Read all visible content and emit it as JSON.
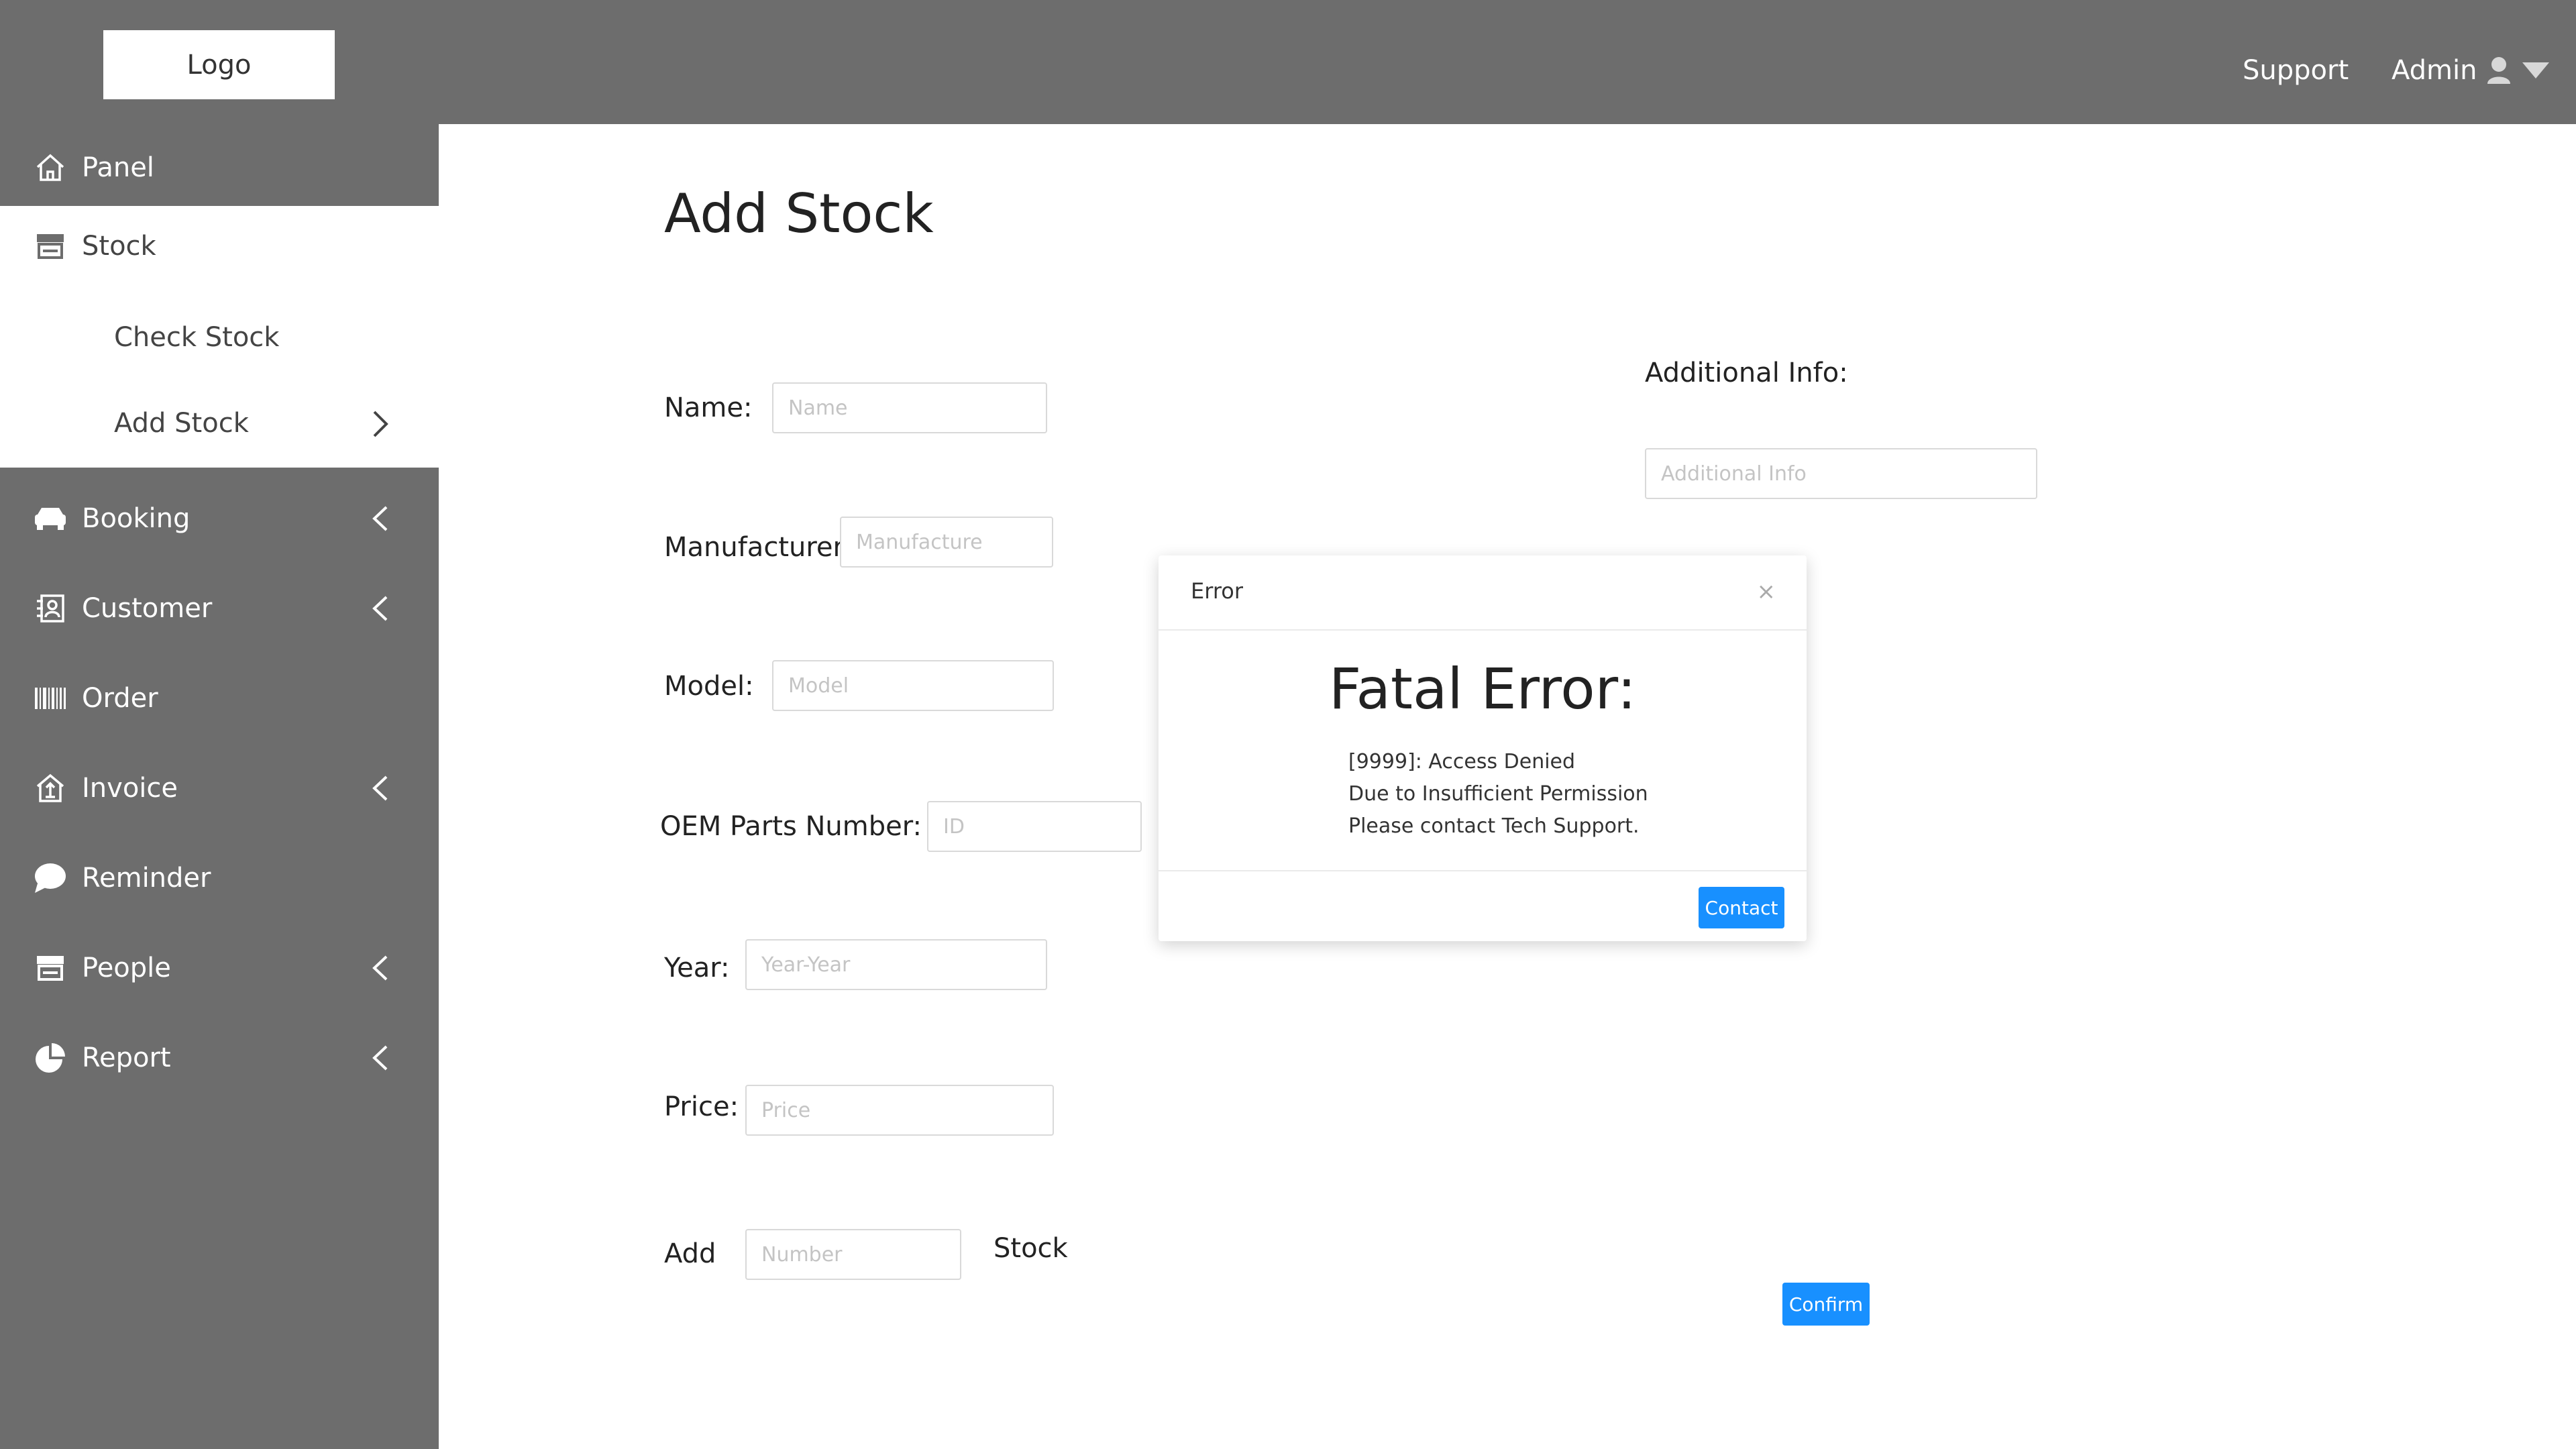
{
  "header": {
    "logo": "Logo",
    "support": "Support",
    "admin": "Admin"
  },
  "sidebar": {
    "items": [
      {
        "label": "Panel",
        "icon": "home-icon"
      },
      {
        "label": "Stock",
        "icon": "store-icon"
      },
      {
        "label": "Booking",
        "icon": "car-icon"
      },
      {
        "label": "Customer",
        "icon": "contact-card-icon"
      },
      {
        "label": "Order",
        "icon": "barcode-icon"
      },
      {
        "label": "Invoice",
        "icon": "invoice-icon"
      },
      {
        "label": "Reminder",
        "icon": "chat-bubble-icon"
      },
      {
        "label": "People",
        "icon": "store-icon"
      },
      {
        "label": "Report",
        "icon": "pie-chart-icon"
      }
    ],
    "stock_sub": [
      "Check Stock",
      "Add Stock"
    ]
  },
  "page": {
    "title": "Add Stock"
  },
  "form": {
    "name_label": "Name:",
    "name_placeholder": "Name",
    "manufacturer_label": "Manufacturer:",
    "manufacturer_placeholder": "Manufacture",
    "model_label": "Model:",
    "model_placeholder": "Model",
    "oem_label": "OEM Parts Number:",
    "oem_placeholder": "ID",
    "year_label": "Year:",
    "year_placeholder": "Year-Year",
    "price_label": "Price:",
    "price_placeholder": "Price",
    "add_label": "Add",
    "number_placeholder": "Number",
    "stock_label": "Stock",
    "additional_label": "Additional Info:",
    "additional_placeholder": "Additional Info",
    "confirm": "Confirm"
  },
  "modal": {
    "title": "Error",
    "close": "×",
    "heading": "Fatal Error:",
    "lines": [
      "[9999]: Access Denied",
      "Due to Insufficient Permission",
      "Please contact Tech Support."
    ],
    "button": "Contact"
  },
  "colors": {
    "chrome": "#6d6d6d",
    "primary": "#1890ff"
  }
}
